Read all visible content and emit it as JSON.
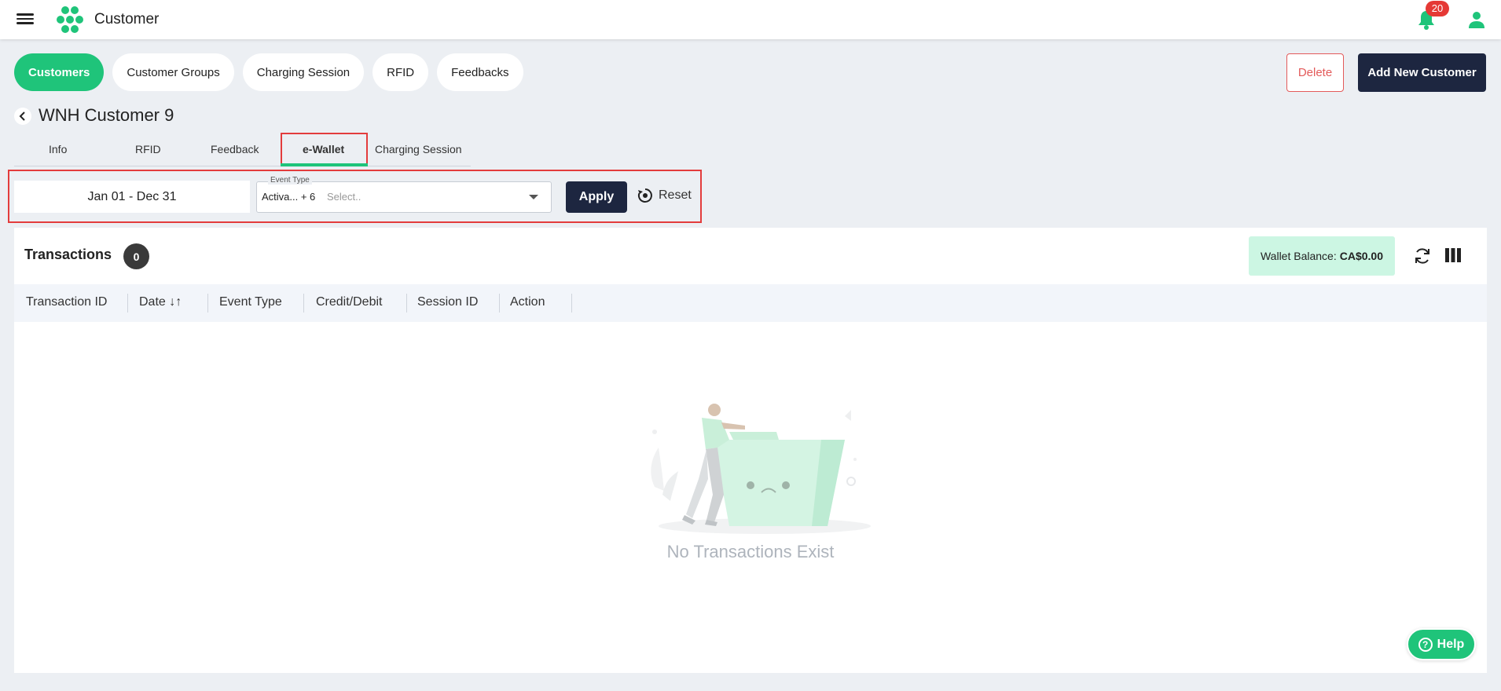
{
  "header": {
    "title": "Customer",
    "notification_count": "20"
  },
  "main_tabs": [
    {
      "label": "Customers",
      "active": true
    },
    {
      "label": "Customer Groups",
      "active": false
    },
    {
      "label": "Charging Session",
      "active": false
    },
    {
      "label": "RFID",
      "active": false
    },
    {
      "label": "Feedbacks",
      "active": false
    }
  ],
  "actions": {
    "delete_label": "Delete",
    "add_label": "Add New Customer"
  },
  "customer": {
    "name": "WNH Customer 9"
  },
  "sub_tabs": [
    {
      "label": "Info"
    },
    {
      "label": "RFID"
    },
    {
      "label": "Feedback"
    },
    {
      "label": "e-Wallet",
      "active": true
    },
    {
      "label": "Charging Session"
    }
  ],
  "filter": {
    "date_range": "Jan 01 - Dec 31",
    "event_type_label": "Event Type",
    "event_type_value": "Activa... + 6",
    "event_type_placeholder": "Select..",
    "apply_label": "Apply",
    "reset_label": "Reset"
  },
  "transactions": {
    "title": "Transactions",
    "count": "0",
    "wallet_label": "Wallet Balance:",
    "wallet_value": "CA$0.00",
    "columns": [
      "Transaction ID",
      "Date ↓↑",
      "Event Type",
      "Credit/Debit",
      "Session ID",
      "Action"
    ],
    "empty_message": "No Transactions Exist"
  },
  "help_label": "Help",
  "colors": {
    "accent": "#1fc47a",
    "dark": "#1d2640",
    "danger": "#e35a5a",
    "highlight_border": "#e33c3c"
  }
}
